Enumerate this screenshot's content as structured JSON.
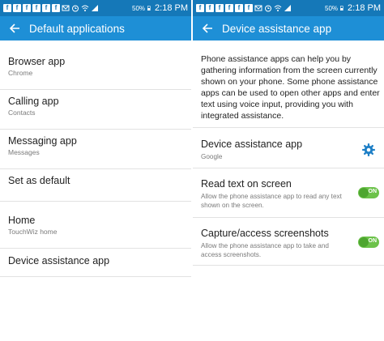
{
  "status_bar": {
    "left_icons": [
      "facebook-icon",
      "facebook-icon",
      "facebook-icon",
      "facebook-icon",
      "facebook-icon",
      "facebook-icon",
      "mail-icon",
      "alarm-icon",
      "signal-icon",
      "signal-icon"
    ],
    "battery_percent": "50%",
    "time": "2:18 PM"
  },
  "left": {
    "title": "Default applications",
    "items": [
      {
        "title": "Browser app",
        "subtitle": "Chrome"
      },
      {
        "title": "Calling app",
        "subtitle": "Contacts"
      },
      {
        "title": "Messaging app",
        "subtitle": "Messages"
      },
      {
        "title": "Set as default",
        "subtitle": ""
      },
      {
        "title": "Home",
        "subtitle": "TouchWiz home"
      },
      {
        "title": "Device assistance app",
        "subtitle": ""
      }
    ]
  },
  "right": {
    "title": "Device assistance app",
    "description": "Phone assistance apps can help you by gathering information from the screen currently shown on your phone. Some phone assistance apps can be used to open other apps and enter text using voice input, providing you with integrated assistance.",
    "settings": [
      {
        "title": "Device assistance app",
        "subtitle": "Google",
        "control": "gear-icon"
      },
      {
        "title": "Read text on screen",
        "subtitle": "Allow the phone assistance app to read any text shown on the screen.",
        "toggle_label": "ON"
      },
      {
        "title": "Capture/access screenshots",
        "subtitle": "Allow the phone assistance app to take and access screenshots.",
        "toggle_label": "ON"
      }
    ]
  },
  "colors": {
    "status_bar": "#1578b8",
    "app_bar": "#1e8fd6",
    "toggle_on": "#6cc24a",
    "gear": "#1e7fc6"
  }
}
